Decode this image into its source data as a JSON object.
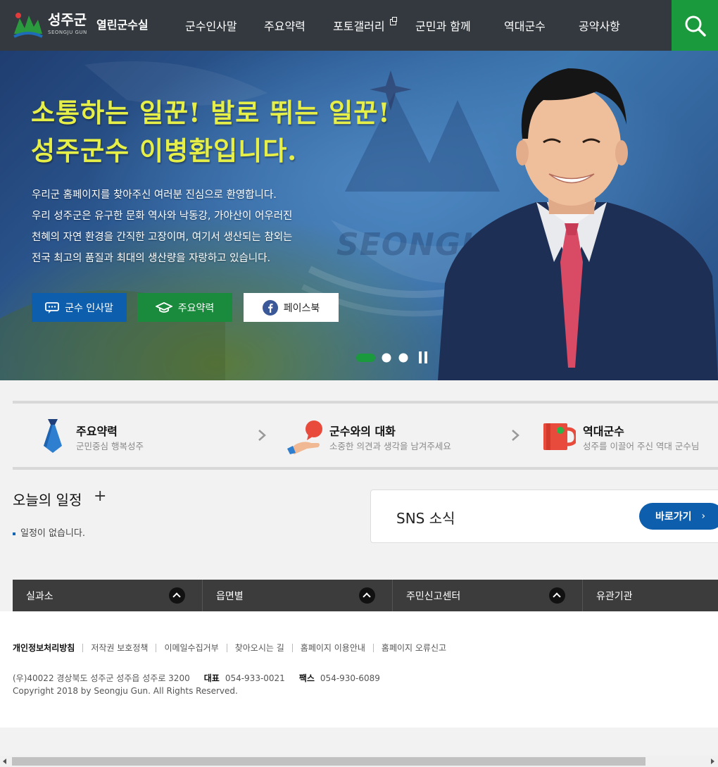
{
  "header": {
    "logo_main": "성주군",
    "logo_sub": "SEONGJU GUN",
    "site_name": "열린군수실",
    "nav": [
      "군수인사말",
      "주요약력",
      "포토갤러리",
      "군민과 함께",
      "역대군수",
      "공약사항"
    ],
    "search_icon": "search-icon"
  },
  "hero": {
    "title_line1": "소통하는 일꾼! 발로 뛰는 일꾼!",
    "title_line2": "성주군수 이병환입니다.",
    "watermark": "SEONGJU",
    "text": [
      "우리군 홈페이지를 찾아주신 여러분 진심으로 환영합니다.",
      "우리 성주군은 유구한 문화 역사와 낙동강, 가야산이 어우러진",
      "천혜의 자연 환경을 간직한 고장이며, 여기서 생산되는 참외는",
      "전국 최고의 품질과 최대의 생산량을 자랑하고 있습니다."
    ],
    "buttons": [
      {
        "label": "군수 인사말",
        "icon": "chat-icon",
        "color": "#0d5fae"
      },
      {
        "label": "주요약력",
        "icon": "graduation-cap-icon",
        "color": "#1a8a3c"
      },
      {
        "label": "페이스북",
        "icon": "facebook-icon",
        "color": "#ffffff"
      }
    ],
    "slider_active": 1,
    "slider_total": 3
  },
  "quick_links": [
    {
      "title": "주요약력",
      "desc": "군민중심 행복성주",
      "icon": "necktie-icon"
    },
    {
      "title": "군수와의 대화",
      "desc": "소중한 의견과 생각을 남겨주세요",
      "icon": "speech-hand-icon"
    },
    {
      "title": "역대군수",
      "desc": "성주를 이끌어 주신 역대 군수님",
      "icon": "cup-icon"
    }
  ],
  "schedule": {
    "title": "오늘의 일정",
    "plus": "+",
    "empty": "일정이 없습니다."
  },
  "sns": {
    "title": "SNS 소식",
    "button": "바로가기",
    "arrow": "›"
  },
  "link_bar": [
    "실과소",
    "읍면별",
    "주민신고센터",
    "유관기관"
  ],
  "footer": {
    "links": [
      "개인정보처리방침",
      "저작권 보호정책",
      "이메일수집거부",
      "찾아오시는 길",
      "홈페이지 이용안내",
      "홈페이지 오류신고"
    ],
    "address": "(우)40022 경상북도 성주군 성주읍 성주로 3200",
    "tel_label": "대표",
    "tel": "054-933-0021",
    "fax_label": "팩스",
    "fax": "054-930-6089",
    "copyright": "Copyright 2018 by Seongju Gun. All Rights Reserved."
  },
  "colors": {
    "header_bg": "#33393f",
    "accent_green": "#1a9a3c",
    "accent_blue": "#0d5fae",
    "title_yellow": "#e6ef47"
  }
}
